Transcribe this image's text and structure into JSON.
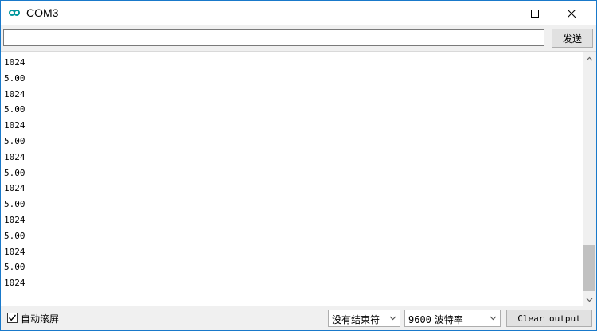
{
  "window": {
    "title": "COM3",
    "icon": "arduino-infinity-icon",
    "accent_color": "#00979d"
  },
  "input_row": {
    "value": "",
    "send_label": "发送"
  },
  "output": {
    "lines": [
      "1024",
      "5.00",
      "1024",
      "5.00",
      "1024",
      "5.00",
      "1024",
      "5.00",
      "1024",
      "5.00",
      "1024",
      "5.00",
      "1024",
      "5.00",
      "1024"
    ],
    "scroll_position": 1.0
  },
  "bottombar": {
    "autoscroll_label": "自动滚屏",
    "autoscroll_checked": true,
    "line_ending": "没有结束符",
    "baud_value": "9600",
    "baud_unit": "波特率",
    "clear_label": "Clear output"
  }
}
